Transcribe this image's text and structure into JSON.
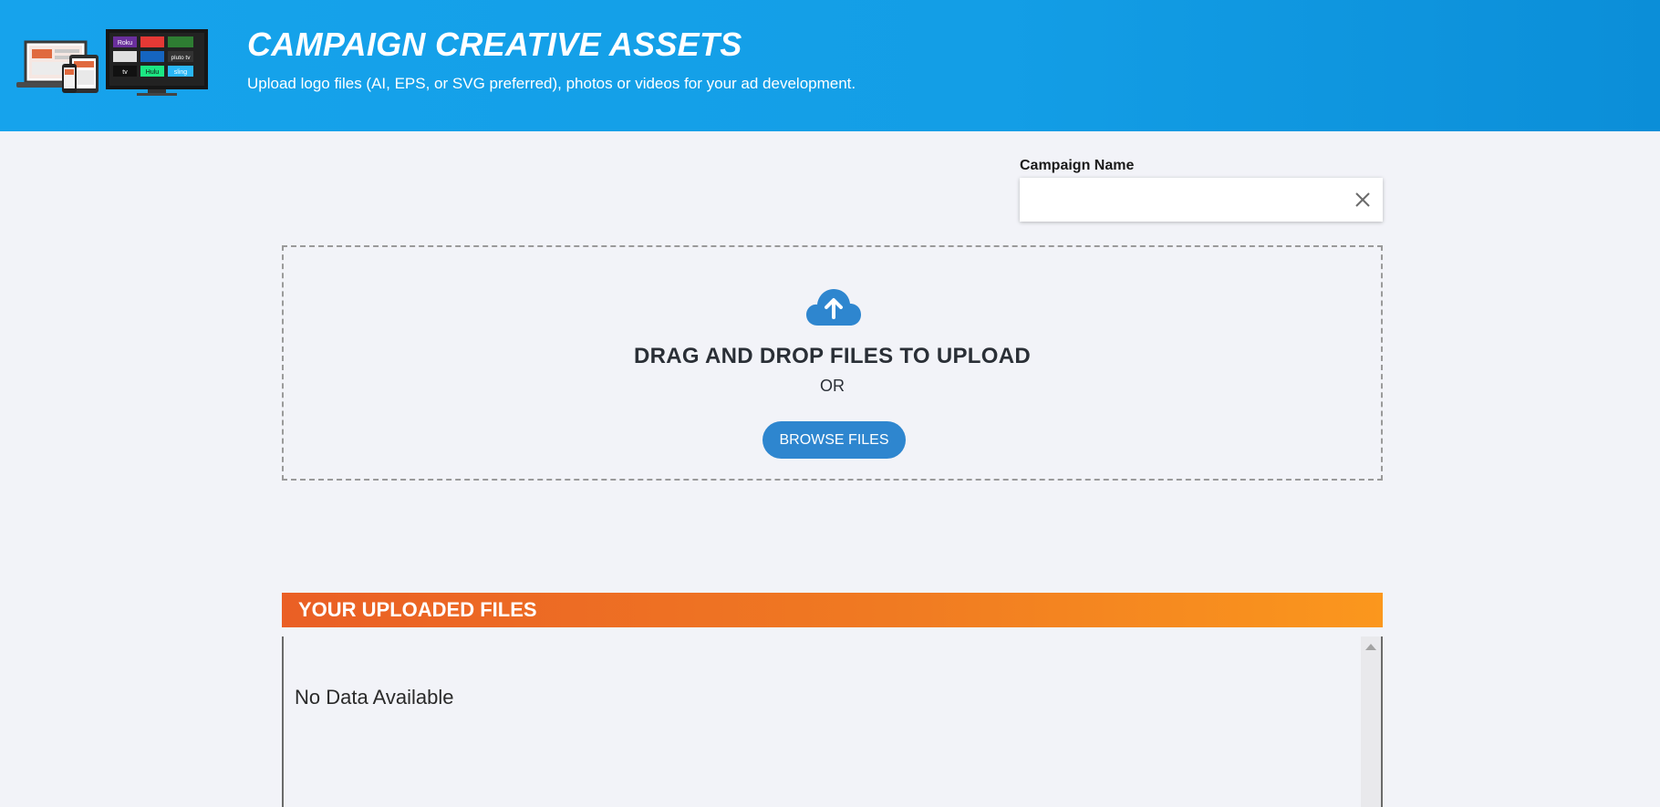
{
  "header": {
    "title": "CAMPAIGN CREATIVE ASSETS",
    "subtitle": "Upload logo files (AI, EPS, or SVG preferred), photos or videos for your ad development.",
    "background_color": "#139ee6",
    "illustration_icon": "devices-streaming-icon",
    "illustration_tiles": [
      "Roku",
      "Hulu",
      "pluto tv",
      "tv",
      "sling"
    ]
  },
  "campaign": {
    "label": "Campaign Name",
    "value": "",
    "placeholder": "",
    "clear_icon": "close-icon"
  },
  "dropzone": {
    "icon": "cloud-upload-icon",
    "title": "DRAG AND DROP FILES TO UPLOAD",
    "or_text": "OR",
    "browse_label": "BROWSE FILES",
    "button_color": "#2e86cf"
  },
  "files": {
    "header": "YOUR UPLOADED FILES",
    "empty_text": "No Data Available",
    "header_gradient": [
      "#ea5f25",
      "#fb971d"
    ]
  }
}
